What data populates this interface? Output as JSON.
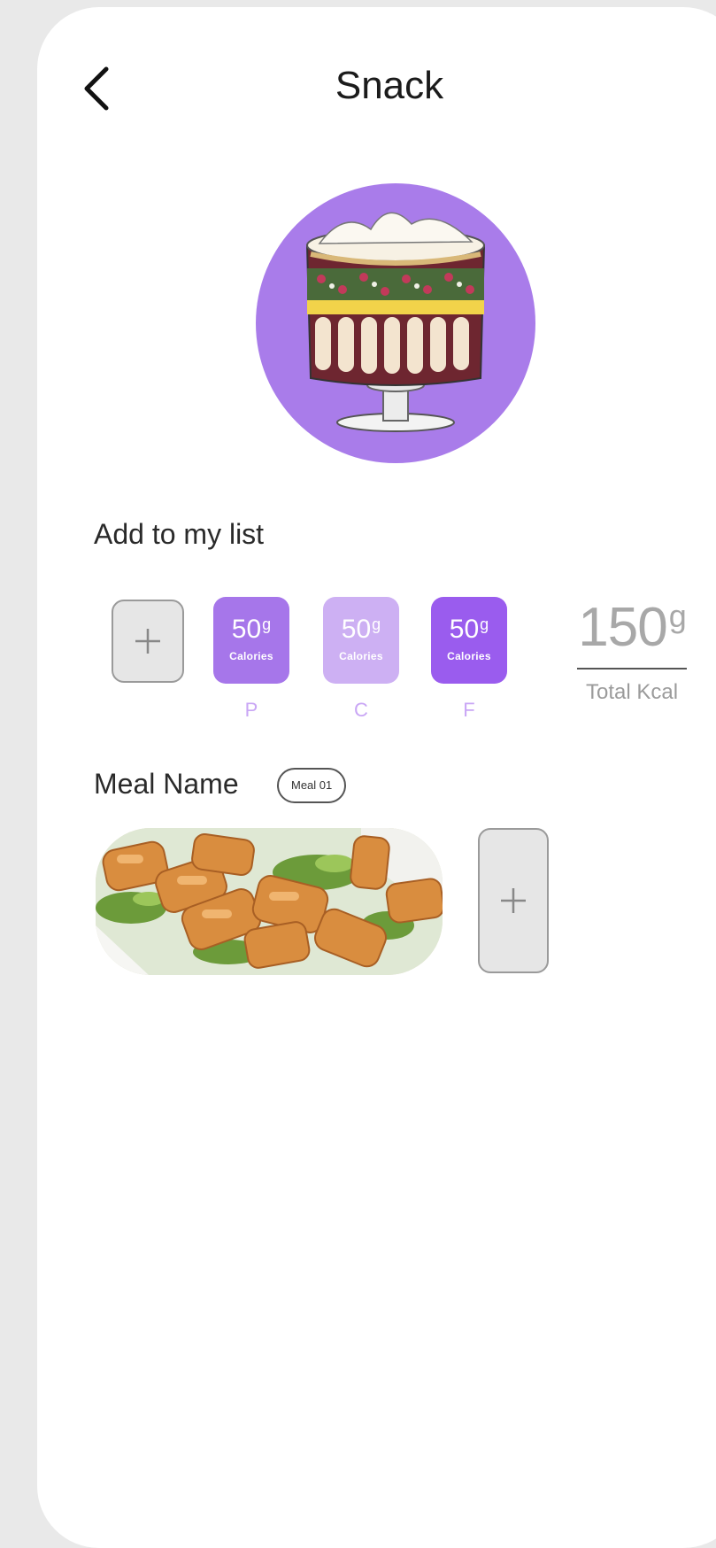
{
  "header": {
    "back_icon": "chevron-left-icon",
    "title": "Snack"
  },
  "hero": {
    "image": "trifle-dessert-illustration",
    "background_color": "#a97cea"
  },
  "add_section": {
    "label": "Add to my list",
    "add_icon": "plus-icon",
    "macros": [
      {
        "value": "50",
        "unit": "g",
        "sub": "Calories",
        "letter": "P",
        "color": "#a676ea"
      },
      {
        "value": "50",
        "unit": "g",
        "sub": "Calories",
        "letter": "C",
        "color": "#cdb0f3"
      },
      {
        "value": "50",
        "unit": "g",
        "sub": "Calories",
        "letter": "F",
        "color": "#9a5cee"
      }
    ],
    "total": {
      "value": "150",
      "unit": "g",
      "label": "Total Kcal"
    }
  },
  "meal_section": {
    "label": "Meal Name",
    "chip": "Meal 01",
    "photo": "grilled-chicken-salad-photo",
    "add_icon": "plus-icon"
  }
}
